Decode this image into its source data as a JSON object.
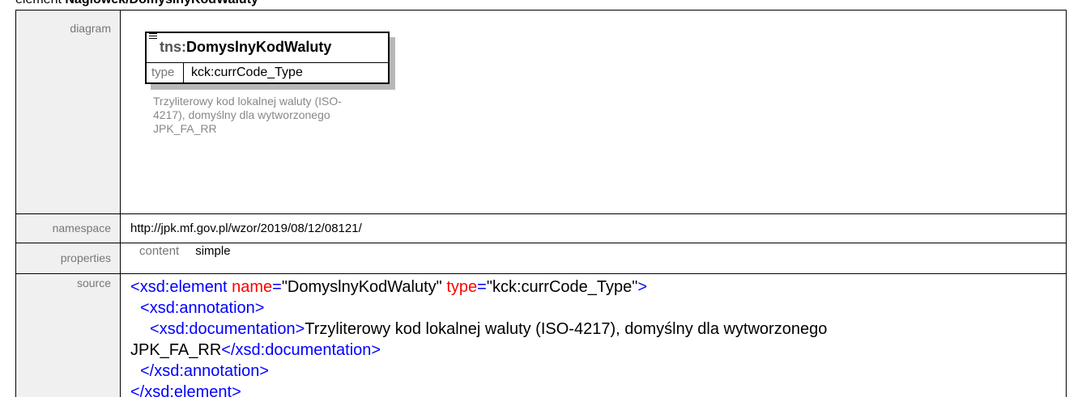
{
  "header": {
    "prefix": "element ",
    "name": "Naglowek/DomyslnyKodWaluty"
  },
  "rows": {
    "diagram_label": "diagram",
    "namespace_label": "namespace",
    "properties_label": "properties",
    "source_label": "source"
  },
  "diagram": {
    "prefix": "tns:",
    "name": "DomyslnyKodWaluty",
    "type_label": "type",
    "type_value": "kck:currCode_Type",
    "documentation": "Trzyliterowy kod lokalnej waluty (ISO-4217), domyślny dla wytworzonego JPK_FA_RR"
  },
  "namespace": "http://jpk.mf.gov.pl/wzor/2019/08/12/08121/",
  "properties": {
    "name": "content",
    "value": "simple"
  },
  "source": {
    "open_bracket": "<",
    "close_bracket": ">",
    "end_open": "</",
    "eq": "=",
    "element_tag": "xsd:element",
    "attr_name": "name",
    "attr_name_value": "\"DomyslnyKodWaluty\"",
    "attr_type": "type",
    "attr_type_value": "\"kck:currCode_Type\"",
    "annotation_tag": "xsd:annotation",
    "documentation_tag": "xsd:documentation",
    "documentation_text": "Trzyliterowy kod lokalnej waluty (ISO-4217), domyślny dla wytworzonego JPK_FA_RR"
  },
  "colors": {
    "label_bg": "#f0f0f0",
    "tag_blue": "#0000ff",
    "tagname_maroon": "#800000",
    "attr_red": "#ff0000"
  }
}
